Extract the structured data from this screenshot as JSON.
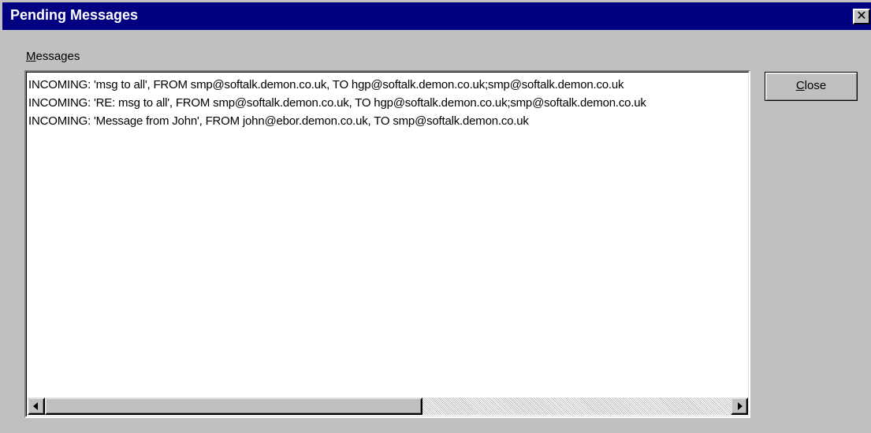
{
  "window": {
    "title": "Pending Messages",
    "close_glyph": "✕"
  },
  "messages_label": {
    "accel": "M",
    "rest": "essages"
  },
  "messages": [
    "INCOMING: 'msg to all', FROM smp@softalk.demon.co.uk, TO hgp@softalk.demon.co.uk;smp@softalk.demon.co.uk",
    "INCOMING: 'RE: msg to all', FROM smp@softalk.demon.co.uk, TO hgp@softalk.demon.co.uk;smp@softalk.demon.co.uk",
    "INCOMING: 'Message from John', FROM john@ebor.demon.co.uk, TO smp@softalk.demon.co.uk"
  ],
  "close_button": {
    "accel": "C",
    "rest": "lose"
  },
  "scrollbar": {
    "position_fraction": 0.0,
    "visible_fraction": 0.55
  },
  "icons": {
    "title_close": "close-icon",
    "scroll_left": "scroll-left-arrow-icon",
    "scroll_right": "scroll-right-arrow-icon"
  }
}
